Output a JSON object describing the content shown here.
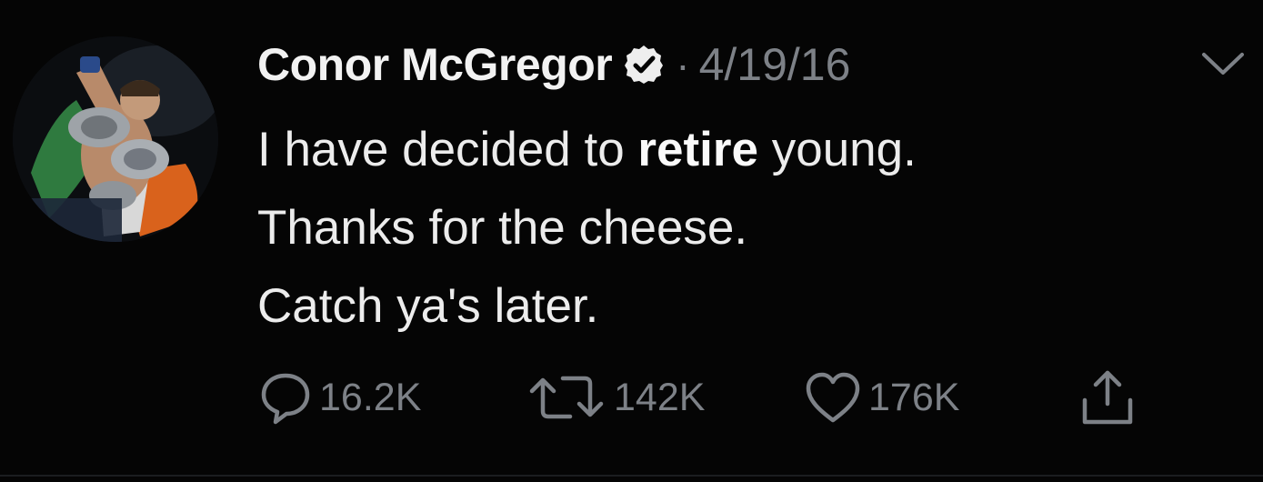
{
  "tweet": {
    "author_name": "Conor McGregor",
    "separator": "·",
    "date": "4/19/16",
    "lines": [
      {
        "before": "I have decided to ",
        "bold": "retire",
        "after": " young."
      },
      {
        "text": "Thanks for the cheese."
      },
      {
        "text": "Catch ya's later."
      }
    ],
    "counts": {
      "replies": "16.2K",
      "retweets": "142K",
      "likes": "176K"
    }
  },
  "icons": {
    "verified": "verified-badge-icon",
    "menu": "chevron-down-icon",
    "reply": "reply-bubble-icon",
    "retweet": "retweet-icon",
    "like": "heart-icon",
    "share": "share-icon"
  },
  "colors": {
    "background": "#050505",
    "text": "#ececec",
    "muted": "#7d8187"
  }
}
